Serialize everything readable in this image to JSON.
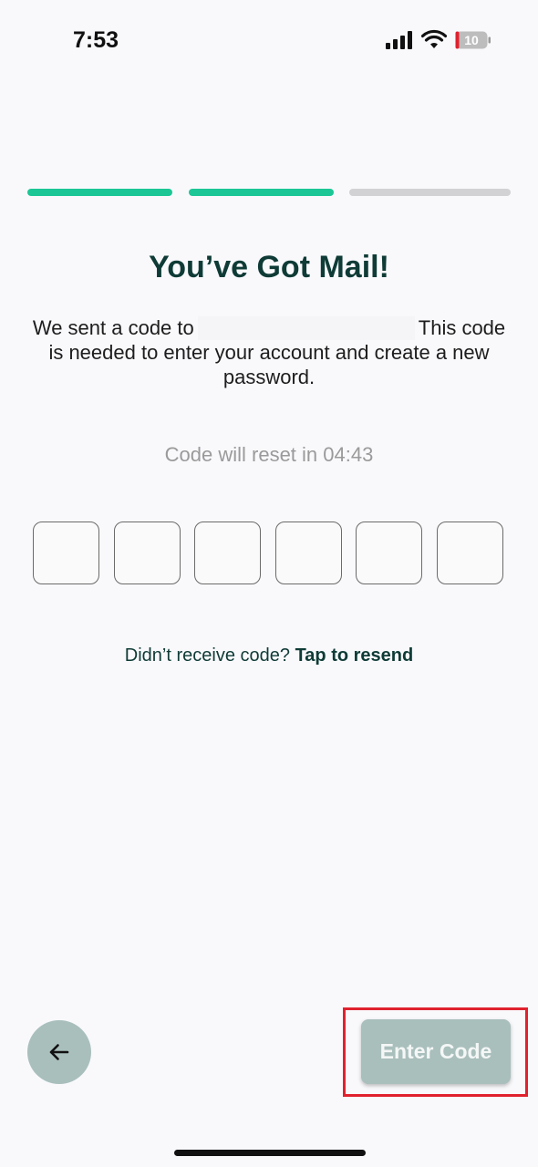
{
  "status_bar": {
    "time": "7:53",
    "battery_level": "10",
    "icons": [
      "signal-icon",
      "wifi-icon",
      "battery-icon"
    ]
  },
  "progress": {
    "total_steps": 3,
    "completed_steps": 2,
    "active_color": "#1cc795",
    "inactive_color": "#d2d2d4"
  },
  "title": "You’ve Got Mail!",
  "message": {
    "before": "We sent a code to",
    "after": "This code is needed to enter your account and create a new password."
  },
  "timer": {
    "label": "Code will reset in",
    "value": "04:43"
  },
  "code_inputs": [
    "",
    "",
    "",
    "",
    "",
    ""
  ],
  "resend": {
    "prompt": "Didn’t receive code?",
    "link": "Tap to resend"
  },
  "footer": {
    "back_icon": "arrow-left-icon",
    "enter_label": "Enter Code",
    "button_color": "#a9bfbc"
  },
  "highlight_color": "#e0222e"
}
